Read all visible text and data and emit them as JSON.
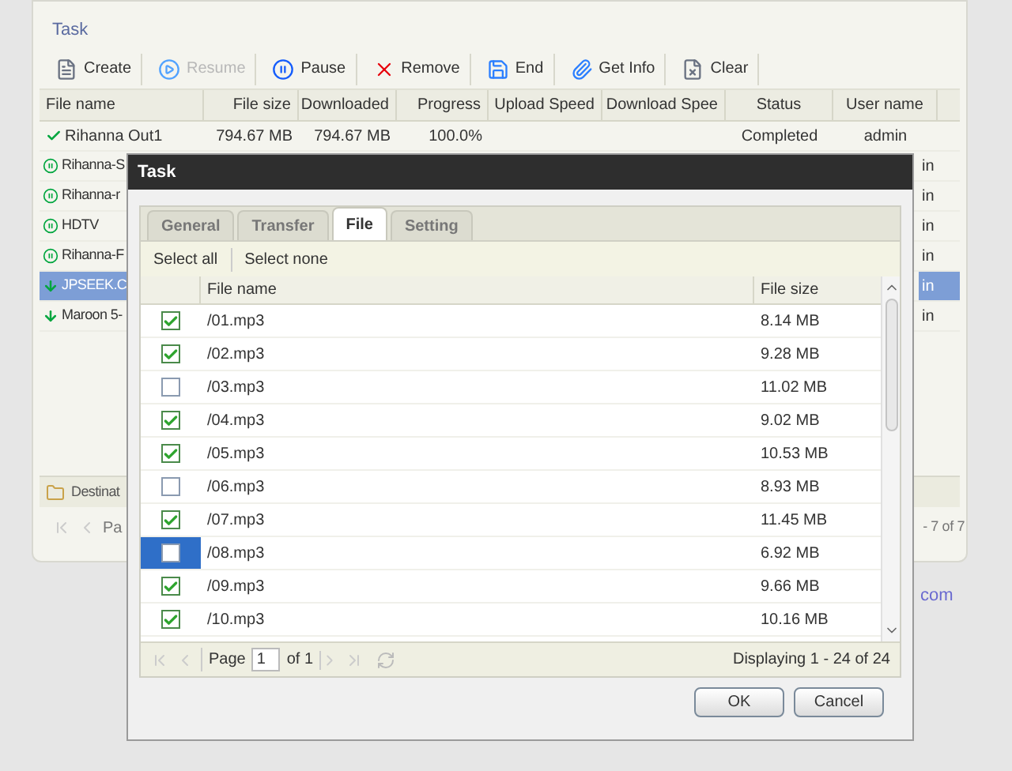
{
  "window": {
    "title": "Task"
  },
  "toolbar": [
    {
      "label": "Create",
      "kind": "create",
      "disabled": false
    },
    {
      "label": "Resume",
      "kind": "resume",
      "disabled": true
    },
    {
      "label": "Pause",
      "kind": "pause",
      "disabled": false
    },
    {
      "label": "Remove",
      "kind": "remove",
      "disabled": false
    },
    {
      "label": "End",
      "kind": "end",
      "disabled": false
    },
    {
      "label": "Get Info",
      "kind": "info",
      "disabled": false
    },
    {
      "label": "Clear",
      "kind": "clear",
      "disabled": false
    }
  ],
  "table": {
    "columns": [
      "File name",
      "File size",
      "Downloaded",
      "Progress",
      "Upload Speed",
      "Download Spee",
      "Status",
      "User name"
    ],
    "first_row": {
      "kind": "done",
      "cells": [
        "Rihanna Out1",
        "794.67 MB",
        "794.67 MB",
        "100.0%",
        "",
        "",
        "Completed",
        "admin"
      ]
    },
    "rows": [
      {
        "name": "Rihanna-S",
        "user": "in",
        "kind": "paused",
        "selected": false
      },
      {
        "name": "Rihanna-r",
        "user": "in",
        "kind": "paused",
        "selected": false
      },
      {
        "name": "HDTV",
        "user": "in",
        "kind": "paused",
        "selected": false
      },
      {
        "name": "Rihanna-F",
        "user": "in",
        "kind": "paused",
        "selected": false
      },
      {
        "name": "JPSEEK.C",
        "user": "in",
        "kind": "downloading",
        "selected": true
      },
      {
        "name": "Maroon 5-",
        "user": "in",
        "kind": "downloading",
        "selected": false
      }
    ]
  },
  "bottom_tab": "Destinat",
  "pager": {
    "page_label": "Pa",
    "count": "- 7 of 7"
  },
  "link_fragment": "com",
  "dialog": {
    "title": "Task",
    "tabs": [
      {
        "label": "General",
        "selected": false
      },
      {
        "label": "Transfer",
        "selected": false
      },
      {
        "label": "File",
        "selected": true
      },
      {
        "label": "Setting",
        "selected": false
      }
    ],
    "actions": [
      "Select all",
      "Select none"
    ],
    "columns": [
      "File name",
      "File size"
    ],
    "files": [
      {
        "name": "/01.mp3",
        "size": "8.14 MB",
        "checked": true,
        "selected": false
      },
      {
        "name": "/02.mp3",
        "size": "9.28 MB",
        "checked": true,
        "selected": false
      },
      {
        "name": "/03.mp3",
        "size": "11.02 MB",
        "checked": false,
        "selected": false
      },
      {
        "name": "/04.mp3",
        "size": "9.02 MB",
        "checked": true,
        "selected": false
      },
      {
        "name": "/05.mp3",
        "size": "10.53 MB",
        "checked": true,
        "selected": false
      },
      {
        "name": "/06.mp3",
        "size": "8.93 MB",
        "checked": false,
        "selected": false
      },
      {
        "name": "/07.mp3",
        "size": "11.45 MB",
        "checked": true,
        "selected": false
      },
      {
        "name": "/08.mp3",
        "size": "6.92 MB",
        "checked": false,
        "selected": true
      },
      {
        "name": "/09.mp3",
        "size": "9.66 MB",
        "checked": true,
        "selected": false
      },
      {
        "name": "/10.mp3",
        "size": "10.16 MB",
        "checked": true,
        "selected": false
      }
    ],
    "pager": {
      "page_label": "Page",
      "page": "1",
      "of": "of 1",
      "display": "Displaying 1 - 24 of 24"
    },
    "buttons": [
      "OK",
      "Cancel"
    ]
  }
}
